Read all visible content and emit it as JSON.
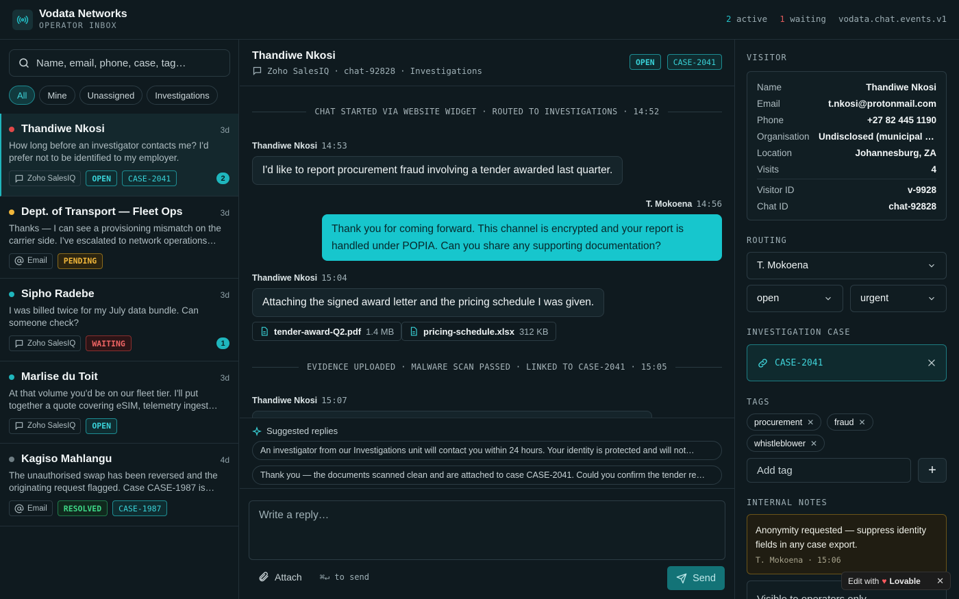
{
  "app": {
    "title": "Vodata Networks",
    "subtitle": "OPERATOR INBOX",
    "status": {
      "active_count": "2",
      "active_label": "active",
      "waiting_count": "1",
      "waiting_label": "waiting",
      "channel": "vodata.chat.events.v1"
    }
  },
  "search": {
    "placeholder": "Name, email, phone, case, tag…"
  },
  "filters": [
    "All",
    "Mine",
    "Unassigned",
    "Investigations"
  ],
  "conversations": [
    {
      "name": "Thandiwe Nkosi",
      "age": "3d",
      "dot_color": "#e04848",
      "preview": "How long before an investigator contacts me? I'd prefer not to be identified to my employer.",
      "source": "Zoho SalesIQ",
      "status": "OPEN",
      "case": "CASE-2041",
      "unread": "2"
    },
    {
      "name": "Dept. of Transport — Fleet Ops",
      "age": "3d",
      "dot_color": "#f0b63a",
      "preview": "Thanks — I can see a provisioning mismatch on the carrier side. I've escalated to network operations…",
      "source": "Email",
      "status": "PENDING"
    },
    {
      "name": "Sipho Radebe",
      "age": "3d",
      "dot_color": "#1fb6bd",
      "preview": "I was billed twice for my July data bundle. Can someone check?",
      "source": "Zoho SalesIQ",
      "status": "WAITING",
      "unread": "1"
    },
    {
      "name": "Marlise du Toit",
      "age": "3d",
      "dot_color": "#1fb6bd",
      "preview": "At that volume you'd be on our fleet tier. I'll put together a quote covering eSIM, telemetry ingest…",
      "source": "Zoho SalesIQ",
      "status": "OPEN"
    },
    {
      "name": "Kagiso Mahlangu",
      "age": "4d",
      "dot_color": "#6e7d83",
      "preview": "The unauthorised swap has been reversed and the originating request flagged. Case CASE-1987 is…",
      "source": "Email",
      "status": "RESOLVED",
      "case": "CASE-1987"
    }
  ],
  "chat": {
    "title": "Thandiwe Nkosi",
    "source": "Zoho SalesIQ",
    "chat_id": "chat-92828",
    "queue": "Investigations",
    "status_badge": "OPEN",
    "case_badge": "CASE-2041",
    "system_1": "CHAT STARTED VIA WEBSITE WIDGET · ROUTED TO INVESTIGATIONS · 14:52",
    "msg1": {
      "author": "Thandiwe Nkosi",
      "time": "14:53",
      "text": "I'd like to report procurement fraud involving a tender awarded last quarter."
    },
    "msg2": {
      "author": "T. Mokoena",
      "time": "14:56",
      "text": "Thank you for coming forward. This channel is encrypted and your report is handled under POPIA. Can you share any supporting documentation?"
    },
    "msg3": {
      "author": "Thandiwe Nkosi",
      "time": "15:04",
      "text": "Attaching the signed award letter and the pricing schedule I was given."
    },
    "attachments": [
      {
        "name": "tender-award-Q2.pdf",
        "size": "1.4 MB"
      },
      {
        "name": "pricing-schedule.xlsx",
        "size": "312 KB"
      }
    ],
    "system_2": "EVIDENCE UPLOADED · MALWARE SCAN PASSED · LINKED TO CASE-2041 · 15:05",
    "msg4": {
      "author": "Thandiwe Nkosi",
      "time": "15:07"
    }
  },
  "suggested": {
    "label": "Suggested replies",
    "items": [
      "An investigator from our Investigations unit will contact you within 24 hours. Your identity is protected and will not…",
      "Thank you — the documents scanned clean and are attached to case CASE-2041. Could you confirm the tender re…"
    ]
  },
  "composer": {
    "placeholder": "Write a reply…",
    "attach_label": "Attach",
    "send_hint": "to send",
    "send_key": "⌘↵",
    "send_label": "Send"
  },
  "visitor": {
    "section": "VISITOR",
    "fields": [
      {
        "k": "Name",
        "v": "Thandiwe Nkosi"
      },
      {
        "k": "Email",
        "v": "t.nkosi@protonmail.com"
      },
      {
        "k": "Phone",
        "v": "+27 82 445 1190"
      },
      {
        "k": "Organisation",
        "v": "Undisclosed (municipal s…"
      },
      {
        "k": "Location",
        "v": "Johannesburg, ZA"
      },
      {
        "k": "Visits",
        "v": "4"
      }
    ],
    "ids": [
      {
        "k": "Visitor ID",
        "v": "v-9928"
      },
      {
        "k": "Chat ID",
        "v": "chat-92828"
      }
    ]
  },
  "routing": {
    "section": "ROUTING",
    "assignee": "T. Mokoena",
    "status": "open",
    "priority": "urgent"
  },
  "investigation": {
    "section": "INVESTIGATION CASE",
    "case": "CASE-2041"
  },
  "tags": {
    "section": "TAGS",
    "items": [
      "procurement",
      "fraud",
      "whistleblower"
    ],
    "add_placeholder": "Add tag"
  },
  "notes": {
    "section": "INTERNAL NOTES",
    "text": "Anonymity requested — suppress identity fields in any case export.",
    "author": "T. Mokoena",
    "time": "15:06",
    "input_placeholder": "Visible to operators only…"
  },
  "lovable": {
    "prefix": "Edit with",
    "brand": "Lovable"
  },
  "colors": {
    "accent": "#1fb6bd",
    "background": "#0f1a1f",
    "danger": "#e05a5a",
    "warning": "#f0b63a",
    "success": "#3dd685"
  }
}
